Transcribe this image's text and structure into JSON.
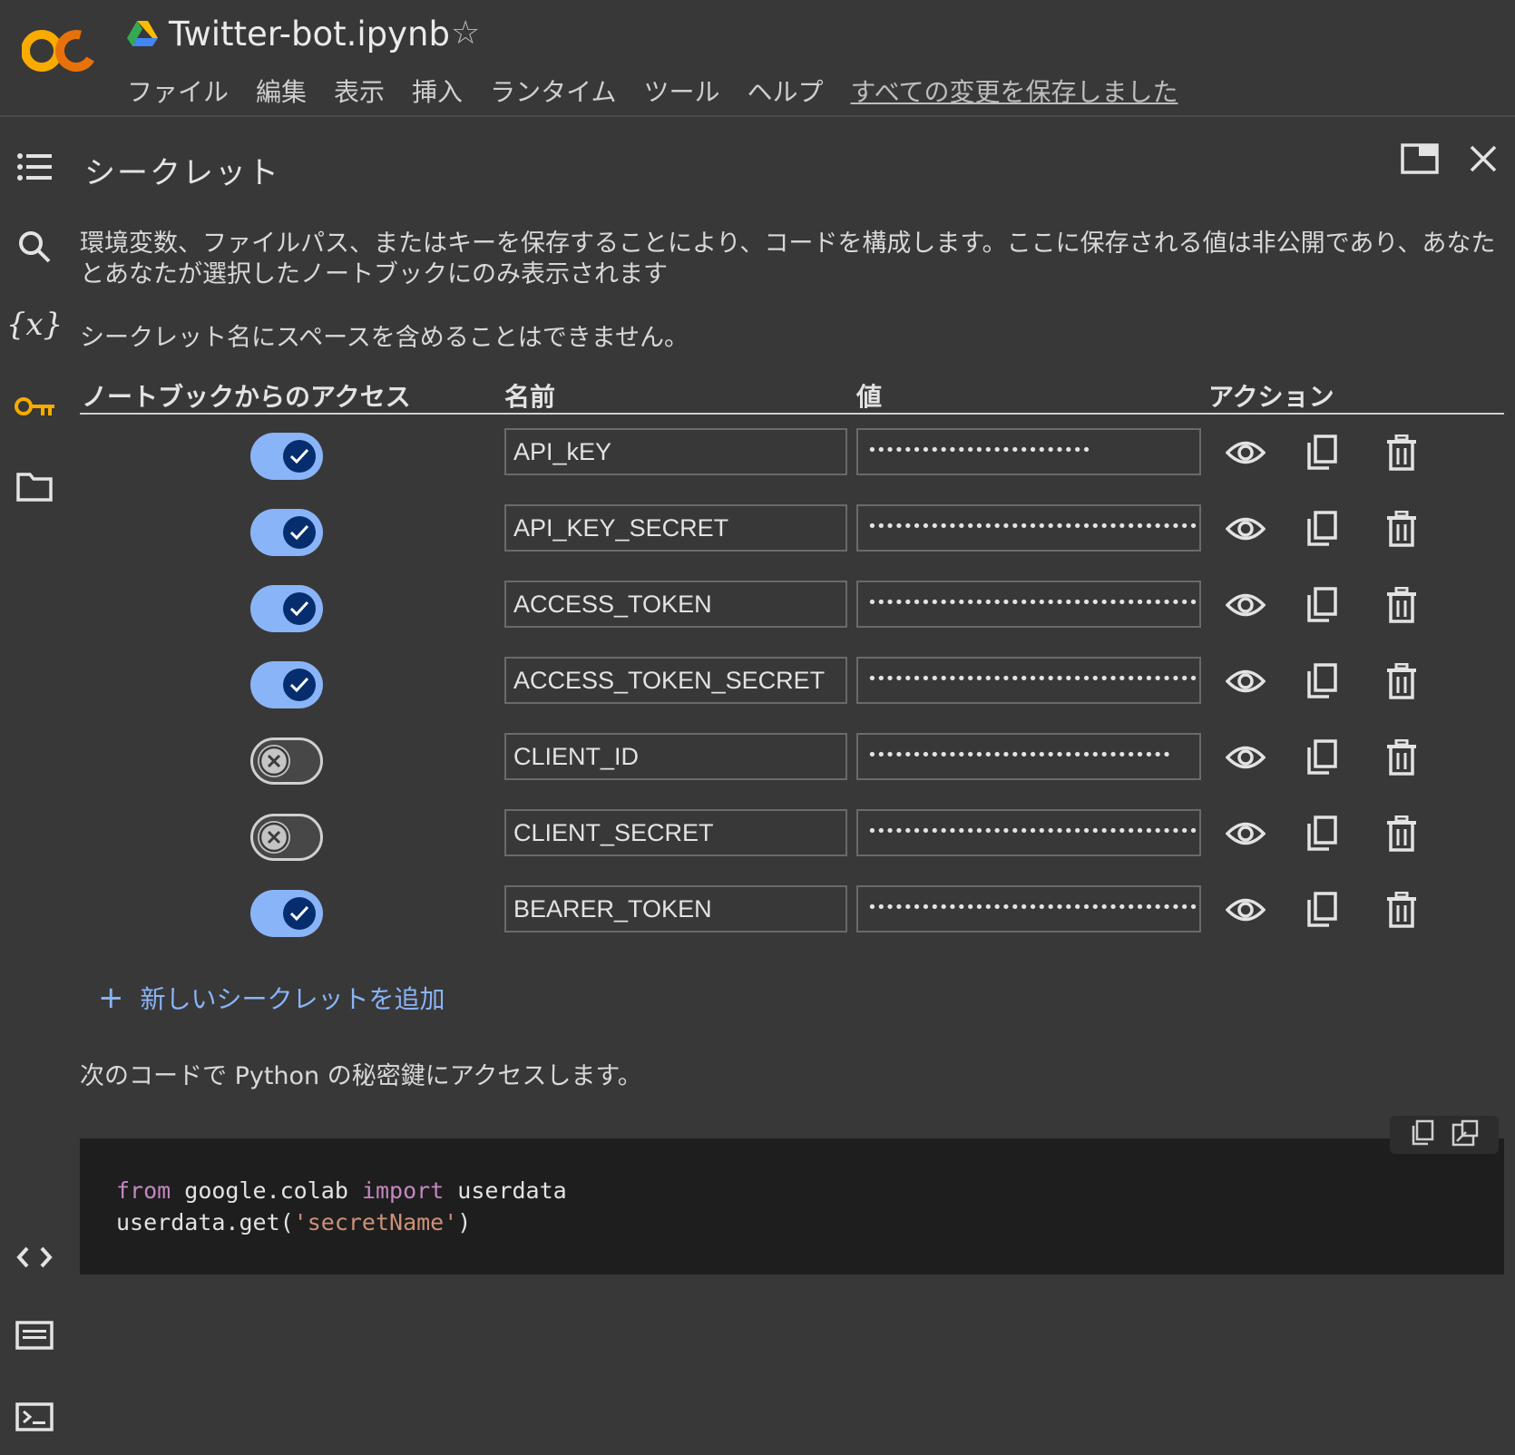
{
  "header": {
    "notebook_title": "Twitter-bot.ipynb",
    "menu": [
      "ファイル",
      "編集",
      "表示",
      "挿入",
      "ランタイム",
      "ツール",
      "ヘルプ"
    ],
    "save_status": "すべての変更を保存しました"
  },
  "panel": {
    "title": "シークレット",
    "description": "環境変数、ファイルパス、またはキーを保存することにより、コードを構成します。ここに保存される値は非公開であり、あなたとあなたが選択したノートブックにのみ表示されます",
    "note": "シークレット名にスペースを含めることはできません。",
    "columns": {
      "access": "ノートブックからのアクセス",
      "name": "名前",
      "value": "値",
      "actions": "アクション"
    },
    "secrets": [
      {
        "access": true,
        "name": "API_kEY",
        "value": "•••••••••••••••••••••••••"
      },
      {
        "access": true,
        "name": "API_KEY_SECRET",
        "value": "••••••••••••••••••••••••••••••••••••••••"
      },
      {
        "access": true,
        "name": "ACCESS_TOKEN",
        "value": "••••••••••••••••••••••••••••••••••••••••"
      },
      {
        "access": true,
        "name": "ACCESS_TOKEN_SECRET",
        "value": "••••••••••••••••••••••••••••••••••••••••"
      },
      {
        "access": false,
        "name": "CLIENT_ID",
        "value": "••••••••••••••••••••••••••••••••••"
      },
      {
        "access": false,
        "name": "CLIENT_SECRET",
        "value": "••••••••••••••••••••••••••••••••••••••••"
      },
      {
        "access": true,
        "name": "BEARER_TOKEN",
        "value": "••••••••••••••••••••••••••••••••••••••••"
      }
    ],
    "add_secret_label": "新しいシークレットを追加",
    "code_note": "次のコードで Python の秘密鍵にアクセスします。",
    "code": {
      "line1_kw1": "from",
      "line1_mid": " google.colab ",
      "line1_kw2": "import",
      "line1_end": " userdata",
      "line2_start": "userdata.get(",
      "line2_str": "'secretName'",
      "line2_end": ")"
    }
  },
  "colors": {
    "background": "#383838",
    "accent": "#8ab4f8",
    "toggle_knob_on": "#062e6f",
    "logo_orange": "#f9ab00"
  }
}
